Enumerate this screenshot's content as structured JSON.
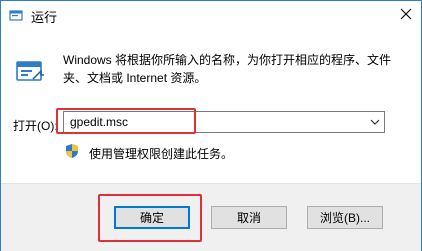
{
  "window": {
    "title": "运行",
    "icon": "run-icon",
    "close_icon": "close-icon"
  },
  "dialog": {
    "description": "Windows 将根据你所输入的名称，为你打开相应的程序、文件夹、文档或 Internet 资源。",
    "open_label": "打开(O):",
    "open_value": "gpedit.msc",
    "admin_notice": "使用管理权限创建此任务。"
  },
  "buttons": {
    "ok": "确定",
    "cancel": "取消",
    "browse": "浏览(B)..."
  },
  "colors": {
    "accent": "#0078d7",
    "highlight": "#e0303a",
    "window_border": "#2f7cc8"
  }
}
